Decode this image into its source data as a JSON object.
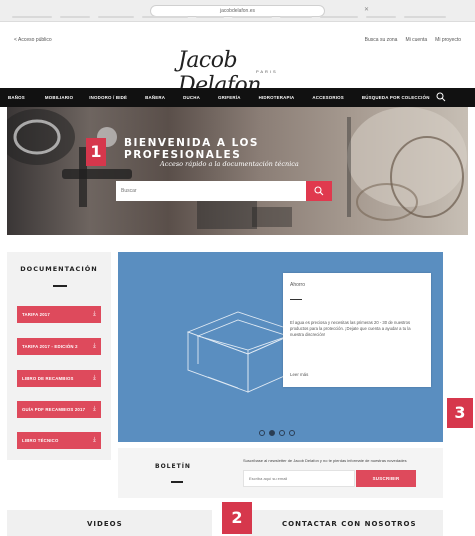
{
  "browser": {
    "url": "jacobdelafon.es"
  },
  "top": {
    "back_link": "< Acceso público",
    "links": [
      "Busca su zona",
      "Mi cuenta",
      "Mi proyecto"
    ]
  },
  "logo": {
    "script": "Jacob Delafon",
    "sub": "PARIS"
  },
  "nav": {
    "items": [
      "BAÑOS",
      "MOBILIARIO",
      "INODORO / BIDÉ",
      "BAÑERA",
      "DUCHA",
      "GRIFERÍA",
      "HIDROTERAPIA",
      "ACCESORIOS",
      "BÚSQUEDA POR COLECCIÓN"
    ]
  },
  "hero": {
    "title": "BIENVENIDA A LOS PROFESIONALES",
    "subtitle": "Acceso rápido a la documentación técnica",
    "search_placeholder": "Buscar"
  },
  "badges": {
    "b1": "1",
    "b2": "2",
    "b3": "3"
  },
  "documentation": {
    "title": "DOCUMENTACIÓN",
    "buttons": [
      "TARIFA 2017",
      "TARIFA 2017 - EDICIÓN 2",
      "LIBRO DE RECAMBIOS",
      "GUÍA PDF RECAMBIOS 2017",
      "LIBRO TÉCNICO"
    ]
  },
  "carousel": {
    "card_tag": "Ahorro",
    "card_text": "El agua es preciosa y necesitas las primeras 20 - 30 de nuestros productos para la protección. ¡Dejate que cuenta a ayudar a tu la nuestra discreción!",
    "card_link": "Leer más"
  },
  "newsletter": {
    "title": "BOLETÍN",
    "text": "Suscríbase al newsletter de Jacob Delafon y no te pierdas informate de nuestras novedades",
    "placeholder": "Escriba aquí su email",
    "button": "SUSCRIBIR"
  },
  "bottom": {
    "videos": "VIDEOS",
    "contact": "CONTACTAR CON NOSOTROS"
  },
  "colors": {
    "accent": "#de4a5c",
    "badge": "#d6374c",
    "carousel_bg": "#5a8ec0",
    "nav_bg": "#111111"
  }
}
